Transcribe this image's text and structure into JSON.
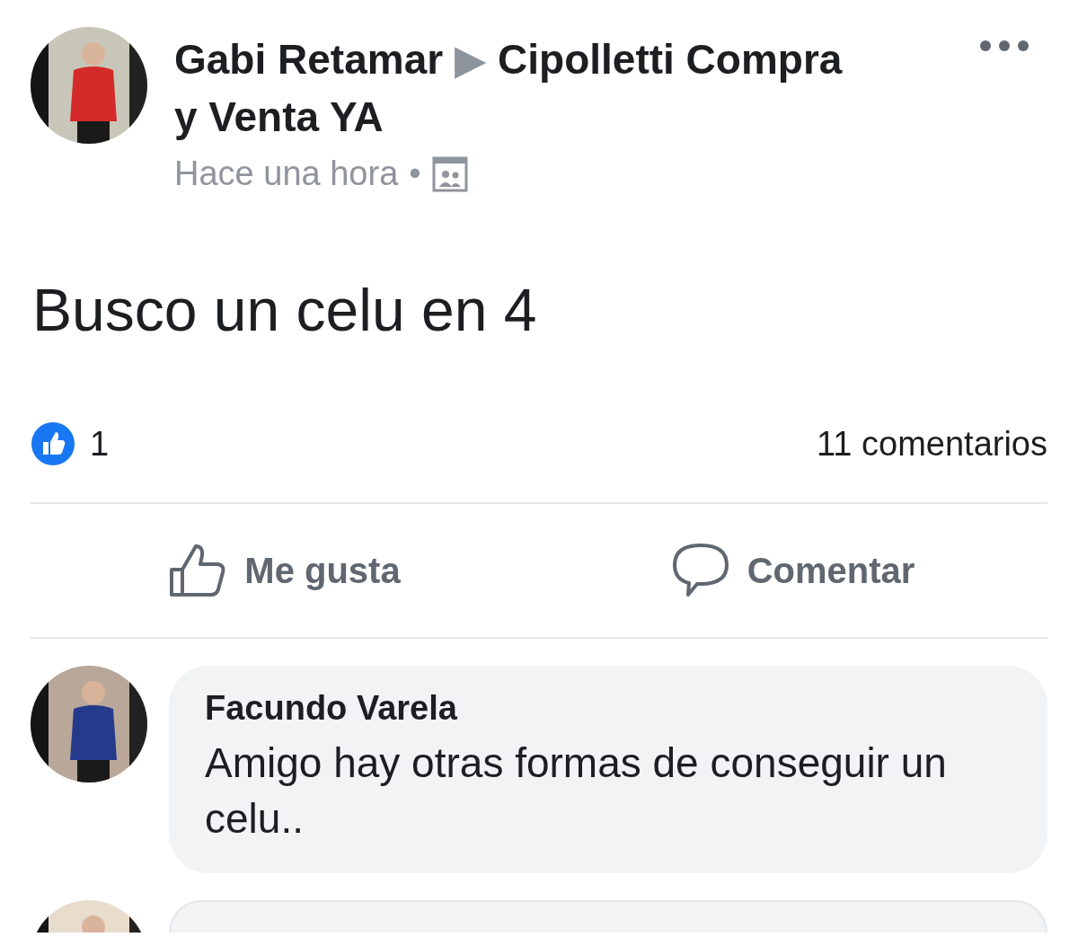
{
  "post": {
    "author": "Gabi Retamar",
    "arrow": "▶",
    "group": "Cipolletti Compra y Venta YA",
    "time": "Hace una hora",
    "separator": "•",
    "avatar": {
      "kind": "picture"
    },
    "text": "Busco un celu en 4",
    "reactions": {
      "count": "1",
      "comments": "11 comentarios"
    },
    "actions": [
      {
        "kind": "like",
        "label": "Me gusta"
      },
      {
        "kind": "comment",
        "label": "Comentar"
      }
    ]
  },
  "comments": [
    {
      "avatar": {
        "kind": "picture"
      },
      "author": "Facundo Varela",
      "text": "Amigo hay otras formas de conseguir un celu.."
    },
    {
      "avatar": {
        "kind": "picture"
      }
    }
  ]
}
